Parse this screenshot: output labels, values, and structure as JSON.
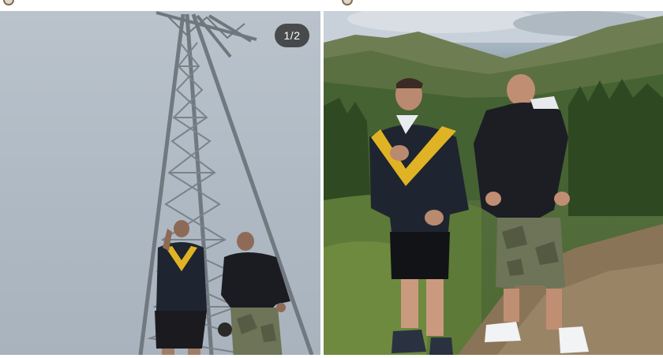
{
  "carousel": {
    "counter_text": "1/2"
  },
  "colors": {
    "sky": "#b3bdc7",
    "tower_steel": "#6e767e",
    "jacket_dark": "#1f2530",
    "jacket_yellow": "#e0b325",
    "jacket_white": "#e9ecef",
    "camo_shorts": "#6d7457",
    "forest_green": "#3e5a2b",
    "trail_brown": "#8a7458"
  },
  "icons": {
    "left_avatar": "profile-avatar-icon",
    "right_avatar": "profile-avatar-icon"
  }
}
